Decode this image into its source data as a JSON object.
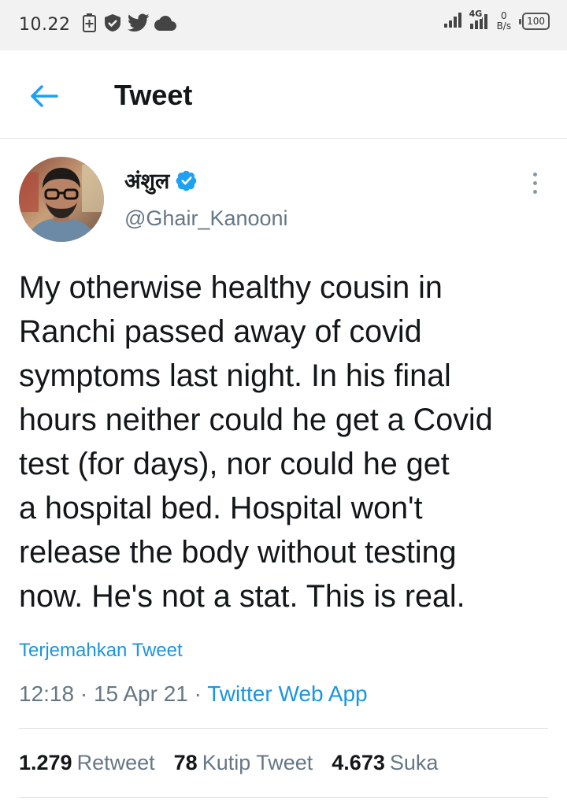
{
  "status_bar": {
    "time": "10.22",
    "network": "4G",
    "speed_value": "0",
    "speed_unit": "B/s",
    "battery": "100"
  },
  "header": {
    "title": "Tweet"
  },
  "tweet": {
    "author_name": "अंशुल",
    "author_handle": "@Ghair_Kanooni",
    "text": "My otherwise healthy cousin in\nRanchi passed away of covid\nsymptoms last night. In his final\nhours neither could he get a Covid\ntest (for days), nor could he get\na hospital bed. Hospital won't\nrelease the body without testing\nnow. He's not a stat. This is real.",
    "translate_label": "Terjemahkan Tweet",
    "time": "12:18",
    "date": "15 Apr 21",
    "app": "Twitter Web App",
    "separator": " · "
  },
  "stats": {
    "retweets": {
      "value": "1.279",
      "label": "Retweet"
    },
    "quotes": {
      "value": "78",
      "label": "Kutip Tweet"
    },
    "likes": {
      "value": "4.673",
      "label": "Suka"
    }
  },
  "colors": {
    "accent": "#1da1f2",
    "link": "#1b95e0",
    "secondary_text": "#657786",
    "primary_text": "#14171a"
  }
}
